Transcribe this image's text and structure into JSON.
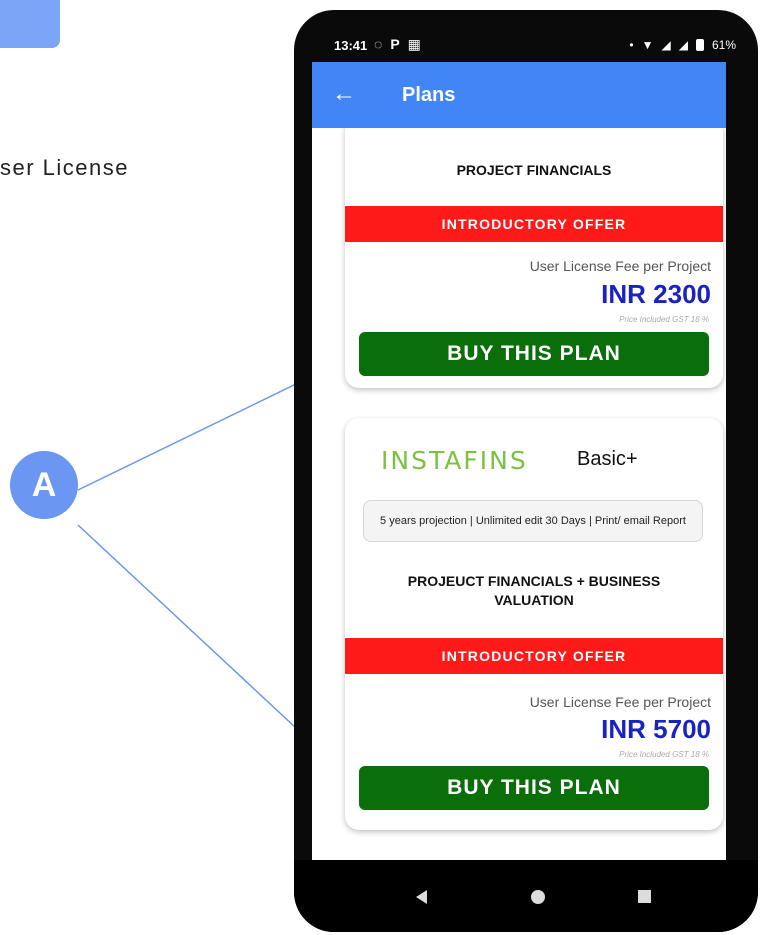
{
  "background_text": "ser License",
  "callout": {
    "label": "A",
    "color": "#6b97f2"
  },
  "status_bar": {
    "time": "13:41",
    "left_icons": [
      "whatsapp-icon",
      "paytm-icon",
      "gallery-icon"
    ],
    "battery": "61%"
  },
  "app_bar": {
    "title": "Plans",
    "color": "#4285f4"
  },
  "plans": [
    {
      "heading": "PROJECT FINANCIALS",
      "offer": "INTRODUCTORY OFFER",
      "fee_label": "User License Fee per Project",
      "price": "INR 2300",
      "gst_note": "Price Included GST 18 %",
      "button": "BUY THIS PLAN"
    },
    {
      "logo": "INSTAFINS",
      "name": "Basic+",
      "features": "5 years projection | Unlimited edit 30 Days | Print/ email Report",
      "heading": "PROJEUCT FINANCIALS + BUSINESS VALUATION",
      "offer": "INTRODUCTORY OFFER",
      "fee_label": "User License Fee per Project",
      "price": "INR 5700",
      "gst_note": "Price Included GST 18 %",
      "button": "BUY THIS PLAN"
    }
  ],
  "colors": {
    "offer_red": "#ff1a1a",
    "button_green": "#0a6e0a",
    "price_blue": "#1a23c2",
    "logo_green": "#7dc142"
  }
}
